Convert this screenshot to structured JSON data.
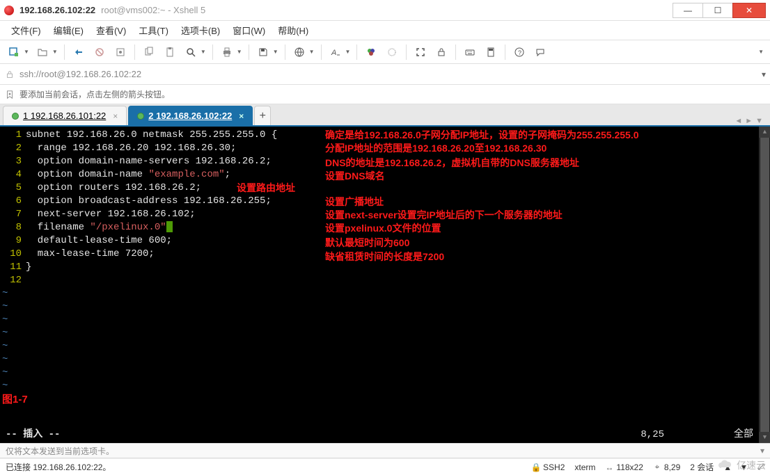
{
  "window": {
    "title_main": "192.168.26.102:22",
    "title_sub": "root@vms002:~ - Xshell 5"
  },
  "menu": {
    "file": "文件(F)",
    "edit": "编辑(E)",
    "view": "查看(V)",
    "tools": "工具(T)",
    "tabs": "选项卡(B)",
    "window": "窗口(W)",
    "help": "帮助(H)"
  },
  "address": {
    "url": "ssh://root@192.168.26.102:22"
  },
  "hint": {
    "text": "要添加当前会话，点击左侧的箭头按钮。"
  },
  "tabs": {
    "tab1": "1 192.168.26.101:22",
    "tab2": "2 192.168.26.102:22",
    "add": "+"
  },
  "code": {
    "l1": "subnet 192.168.26.0 netmask 255.255.255.0 {",
    "l2": "  range 192.168.26.20 192.168.26.30;",
    "l3": "  option domain-name-servers 192.168.26.2;",
    "l4a": "  option domain-name ",
    "l4s": "\"example.com\"",
    "l4b": ";",
    "l5": "  option routers 192.168.26.2;",
    "l6": "  option broadcast-address 192.168.26.255;",
    "l7": "  next-server 192.168.26.102;",
    "l8a": "  filename ",
    "l8s": "\"/pxelinux.0\"",
    "l9": "  default-lease-time 600;",
    "l10": "  max-lease-time 7200;",
    "l11": "}",
    "fig": "图1-7"
  },
  "annotations": {
    "a1": "确定是给192.168.26.0子网分配IP地址，设置的子网掩码为255.255.255.0",
    "a2": "分配IP地址的范围是192.168.26.20至192.168.26.30",
    "a3": "DNS的地址是192.168.26.2，虚拟机自带的DNS服务器地址",
    "a4": "设置DNS域名",
    "a5": "设置路由地址",
    "a6": "设置广播地址",
    "a7": "设置next-server设置完IP地址后的下一个服务器的地址",
    "a8": " 设置pxelinux.0文件的位置",
    "a9": "默认最短时间为600",
    "a10": "缺省租赁时间的长度是7200"
  },
  "vim_status": {
    "mode": "-- 插入 --",
    "pos": "8,25",
    "pct": "全部"
  },
  "send_hint": "仅将文本发送到当前选项卡。",
  "status": {
    "conn": "已连接 192.168.26.102:22。",
    "proto": "SSH2",
    "term": "xterm",
    "size": "118x22",
    "caret": "8,29",
    "sessions": "2 会话"
  },
  "watermark": "亿速云"
}
